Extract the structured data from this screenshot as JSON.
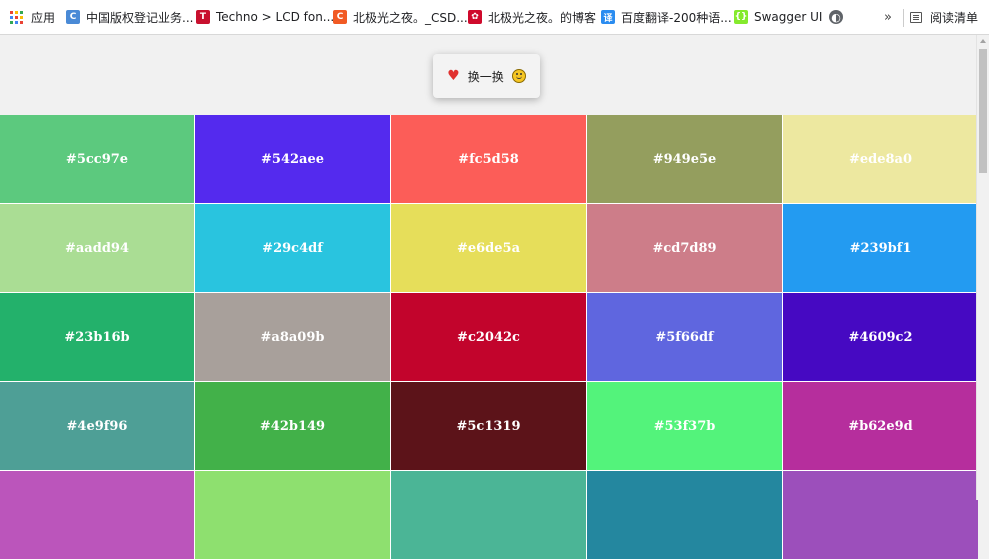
{
  "bookmarks_bar": {
    "apps": {
      "label": "应用",
      "icon": "apps-grid-icon"
    },
    "items": [
      {
        "label": "中国版权登记业务...",
        "icon": "copyright-c-icon",
        "icon_color": "#4a8ad6",
        "glyph": "C"
      },
      {
        "label": "Techno > LCD fon...",
        "icon": "techno-logo-icon",
        "icon_color": "#c8102e",
        "glyph": "T"
      },
      {
        "label": "北极光之夜。_CSD...",
        "icon": "csdn-c-icon",
        "icon_color": "#f15a24",
        "glyph": "C"
      },
      {
        "label": "北极光之夜。的博客",
        "icon": "huawei-logo-icon",
        "icon_color": "#cf0a2c",
        "glyph": "✿"
      },
      {
        "label": "百度翻译-200种语...",
        "icon": "baidu-translate-icon",
        "icon_color": "#2a8cf0",
        "glyph": "译"
      },
      {
        "label": "Swagger UI",
        "icon": "swagger-icon",
        "icon_color": "#85ea2d",
        "glyph": "{}"
      },
      {
        "label": "",
        "icon": "globe-icon",
        "icon_color": "#5f6368",
        "glyph": "◐"
      }
    ],
    "more": "»",
    "reading_list": {
      "label": "阅读清单",
      "icon": "reading-list-icon"
    }
  },
  "shuffle_button": {
    "label": "换一换",
    "left_icon": "heart-icon",
    "right_icon": "smiley-icon"
  },
  "colors": [
    "#5cc97e",
    "#542aee",
    "#fc5d58",
    "#949e5e",
    "#ede8a0",
    "#aadd94",
    "#29c4df",
    "#e6de5a",
    "#cd7d89",
    "#239bf1",
    "#23b16b",
    "#a8a09b",
    "#c2042c",
    "#5f66df",
    "#4609c2",
    "#4e9f96",
    "#42b149",
    "#5c1319",
    "#53f37b",
    "#b62e9d",
    "#bb55bb",
    "#8ee06f",
    "#4bb596",
    "#24879f",
    "#9c4fbb"
  ],
  "partial_row_hidden_labels": true
}
